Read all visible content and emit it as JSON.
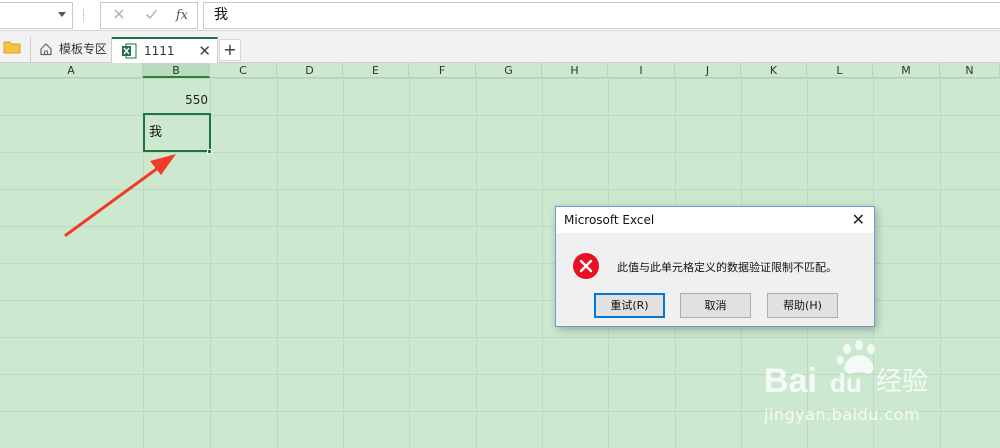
{
  "formula_bar": {
    "name_box_value": "",
    "cancel_icon": "x-icon",
    "confirm_icon": "check-icon",
    "fx_label": "fx",
    "formula_value": "我"
  },
  "tabs": {
    "templates_label": "模板专区",
    "file_label": "1111",
    "close_symbol": "✕",
    "add_symbol": "+"
  },
  "sheet": {
    "columns": [
      "A",
      "B",
      "C",
      "D",
      "E",
      "F",
      "G",
      "H",
      "I",
      "J",
      "K",
      "L",
      "M",
      "N"
    ],
    "active_column": "B",
    "cells": {
      "b2_value": "550",
      "b3_value": "我"
    }
  },
  "dialog": {
    "title": "Microsoft Excel",
    "close_symbol": "✕",
    "message": "此值与此单元格定义的数据验证限制不匹配。",
    "retry_label": "重试(R)",
    "cancel_label": "取消",
    "help_label": "帮助(H)"
  },
  "watermark": {
    "site": "jingyan.baidu.com",
    "logo": "Bai du 经验"
  },
  "colors": {
    "sheet_bg": "#cce8cf",
    "selection_border": "#217346",
    "arrow": "#f03c28",
    "error_icon": "#e81123"
  }
}
